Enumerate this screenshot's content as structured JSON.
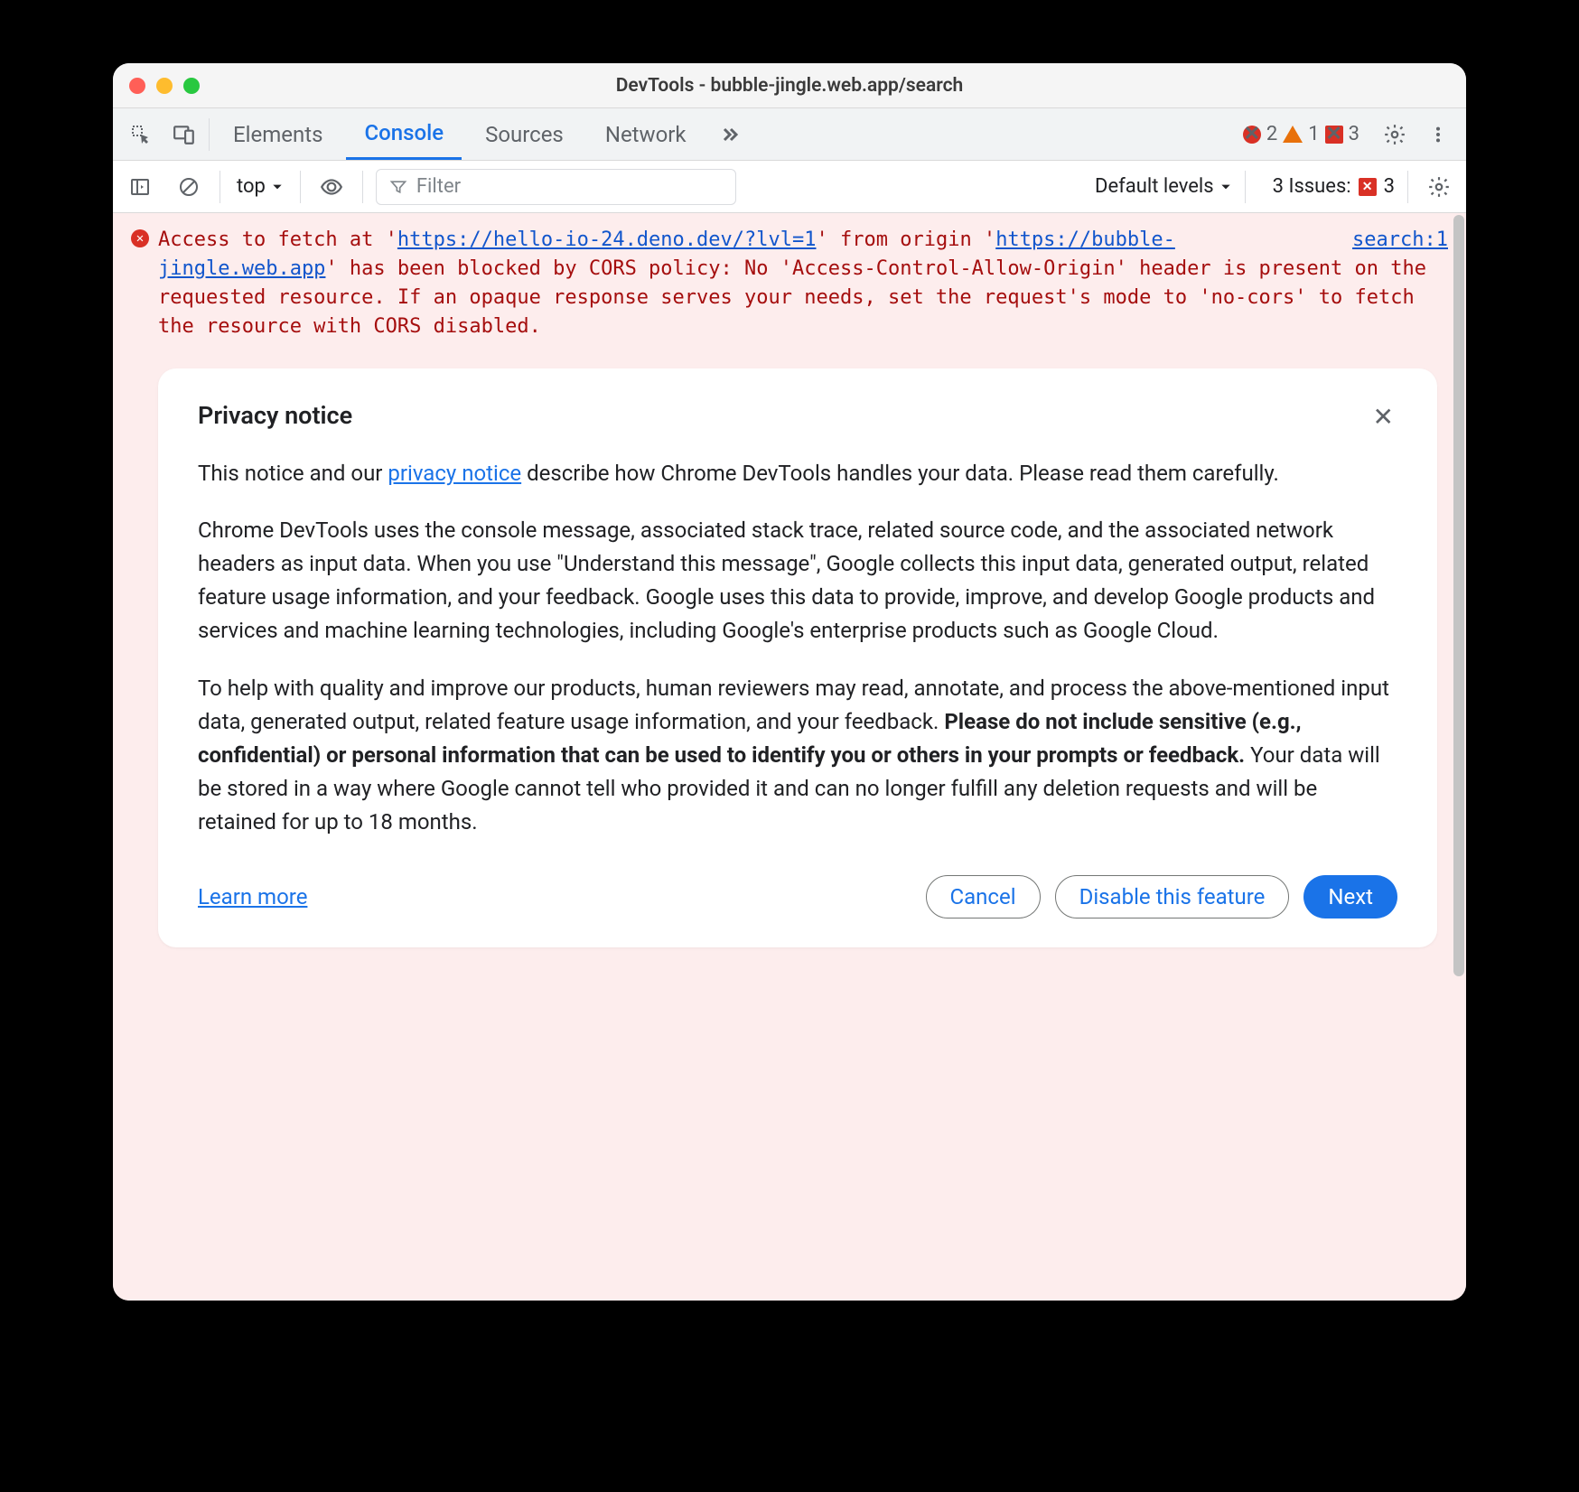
{
  "window": {
    "title": "DevTools - bubble-jingle.web.app/search"
  },
  "tabs": {
    "elements": "Elements",
    "console": "Console",
    "sources": "Sources",
    "network": "Network"
  },
  "status": {
    "errors": "2",
    "warnings": "1",
    "issues": "3"
  },
  "filter": {
    "context": "top",
    "placeholder": "Filter",
    "levels": "Default levels",
    "issues_label": "3 Issues:",
    "issues_count": "3"
  },
  "error": {
    "pre1": "Access to fetch at '",
    "link1": "https://hello-io-24.deno.dev/?lvl=1",
    "mid1": "' from origin '",
    "link2": "https://bubble-jingle.web.app",
    "post": "' has been blocked by CORS policy: No 'Access-Control-Allow-Origin' header is present on the requested resource. If an opaque response serves your needs, set the request's mode to 'no-cors' to fetch the resource with CORS disabled.",
    "source": "search:1"
  },
  "privacy": {
    "title": "Privacy notice",
    "p1_a": "This notice and our ",
    "p1_link": "privacy notice",
    "p1_b": " describe how Chrome DevTools handles your data. Please read them carefully.",
    "p2": "Chrome DevTools uses the console message, associated stack trace, related source code, and the associated network headers as input data. When you use \"Understand this message\", Google collects this input data, generated output, related feature usage information, and your feedback. Google uses this data to provide, improve, and develop Google products and services and machine learning technologies, including Google's enterprise products such as Google Cloud.",
    "p3_a": "To help with quality and improve our products, human reviewers may read, annotate, and process the above-mentioned input data, generated output, related feature usage information, and your feedback. ",
    "p3_bold": "Please do not include sensitive (e.g., confidential) or personal information that can be used to identify you or others in your prompts or feedback.",
    "p3_b": " Your data will be stored in a way where Google cannot tell who provided it and can no longer fulfill any deletion requests and will be retained for up to 18 months.",
    "learn_more": "Learn more",
    "cancel": "Cancel",
    "disable": "Disable this feature",
    "next": "Next"
  }
}
